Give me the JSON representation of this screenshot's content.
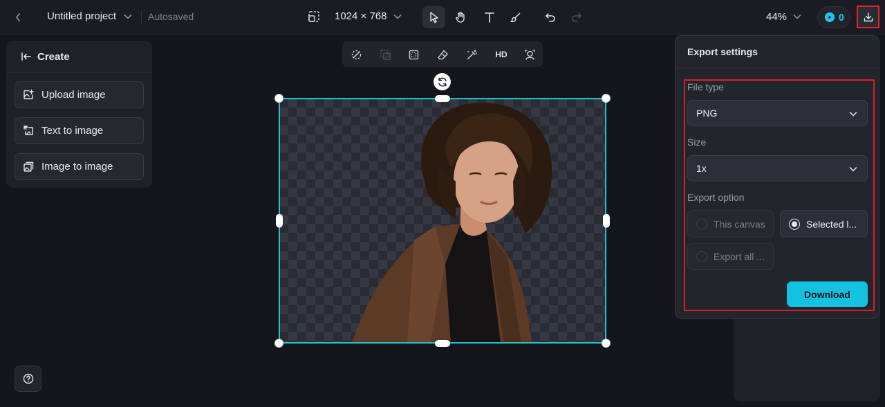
{
  "topbar": {
    "project_title": "Untitled project",
    "save_status": "Autosaved",
    "canvas_size": "1024 × 768",
    "zoom": "44%",
    "credits": "0"
  },
  "left_panel": {
    "header": "Create",
    "items": [
      {
        "label": "Upload image",
        "icon": "upload-image-icon"
      },
      {
        "label": "Text to image",
        "icon": "text-to-image-icon"
      },
      {
        "label": "Image to image",
        "icon": "image-to-image-icon"
      }
    ]
  },
  "image_toolbar": {
    "hd_label": "HD"
  },
  "export_settings": {
    "title": "Export settings",
    "file_type_label": "File type",
    "file_type_value": "PNG",
    "size_label": "Size",
    "size_value": "1x",
    "export_option_label": "Export option",
    "options": [
      {
        "label": "This canvas",
        "selected": false
      },
      {
        "label": "Selected l...",
        "selected": true
      },
      {
        "label": "Export all ...",
        "selected": false
      }
    ],
    "download_label": "Download"
  },
  "colors": {
    "accent": "#13c2e0",
    "selection": "#1fc3c9",
    "highlight": "#dd1f28"
  }
}
